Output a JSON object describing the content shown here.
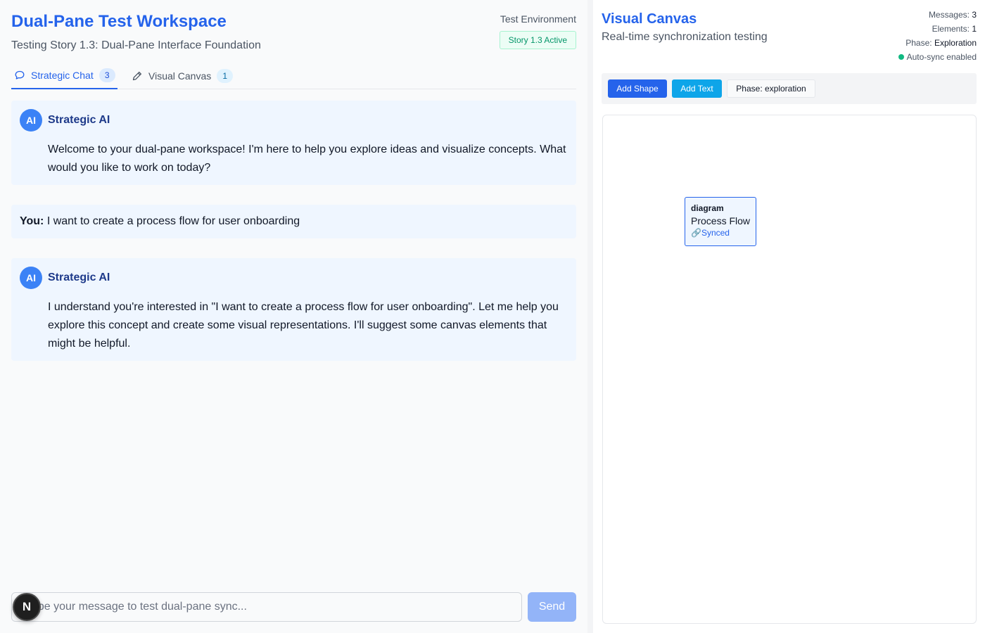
{
  "workspace": {
    "title": "Dual-Pane Test Workspace",
    "subtitle": "Testing Story 1.3: Dual-Pane Interface Foundation",
    "environment": "Test Environment",
    "story_badge": "Story 1.3 Active"
  },
  "tabs": [
    {
      "label": "Strategic Chat",
      "count": "3",
      "icon": "chat-bubble-icon",
      "active": true
    },
    {
      "label": "Visual Canvas",
      "count": "1",
      "icon": "pencil-icon",
      "active": false
    }
  ],
  "messages": [
    {
      "role": "ai",
      "avatar": "AI",
      "sender": "Strategic AI",
      "text": "Welcome to your dual-pane workspace! I'm here to help you explore ideas and visualize concepts. What would you like to work on today?"
    },
    {
      "role": "user",
      "sender": "You:",
      "text": "I want to create a process flow for user onboarding"
    },
    {
      "role": "ai",
      "avatar": "AI",
      "sender": "Strategic AI",
      "text": "I understand you're interested in \"I want to create a process flow for user onboarding\". Let me help you explore this concept and create some visual representations. I'll suggest some canvas elements that might be helpful."
    }
  ],
  "composer": {
    "placeholder": "Type your message to test dual-pane sync...",
    "value": "",
    "send_label": "Send",
    "badge_letter": "N"
  },
  "canvas": {
    "title": "Visual Canvas",
    "subtitle": "Real-time synchronization testing",
    "stats": {
      "messages_label": "Messages:",
      "messages_value": "3",
      "elements_label": "Elements:",
      "elements_value": "1",
      "phase_label": "Phase:",
      "phase_value": "Exploration",
      "sync_label": "Auto-sync enabled"
    },
    "toolbar": {
      "add_shape": "Add Shape",
      "add_text": "Add Text",
      "phase": "Phase: exploration"
    },
    "elements": [
      {
        "type": "diagram",
        "label": "Process Flow",
        "sync_icon": "🔗",
        "sync_status": "Synced"
      }
    ]
  },
  "colors": {
    "accent": "#2563eb",
    "ai_bubble": "#eff6ff",
    "sync_green": "#10b981",
    "add_text_button": "#0ea5e9"
  }
}
